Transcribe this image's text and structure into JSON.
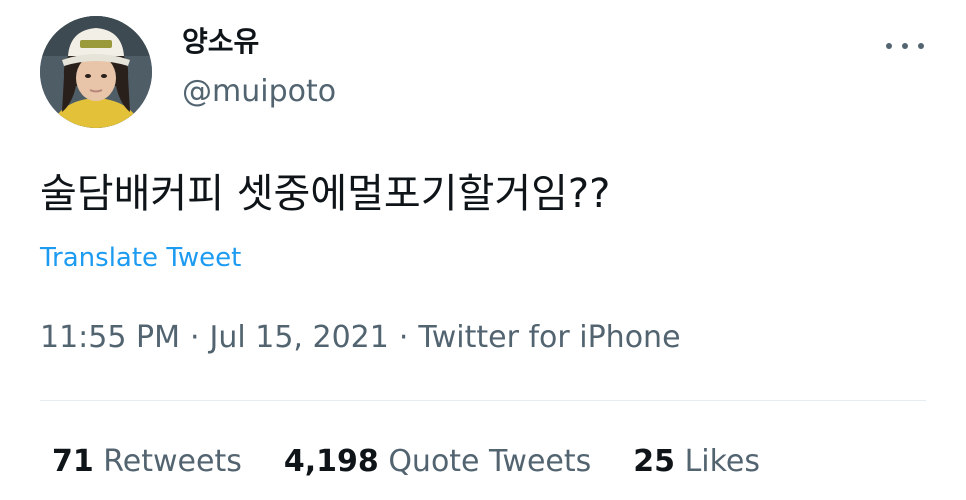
{
  "user": {
    "display_name": "양소유",
    "handle": "@muipoto",
    "avatar_icon": "profile-photo"
  },
  "more_icon": "more-horizontal-icon",
  "tweet": {
    "text": "술담배커피 셋중에멀포기할거임??",
    "translate_label": "Translate Tweet",
    "time": "11:55 PM",
    "separator": "·",
    "date": "Jul 15, 2021",
    "source": "Twitter for iPhone"
  },
  "stats": {
    "retweets": {
      "count": "71",
      "label": "Retweets"
    },
    "quote_tweets": {
      "count": "4,198",
      "label": "Quote Tweets"
    },
    "likes": {
      "count": "25",
      "label": "Likes"
    }
  },
  "colors": {
    "link": "#1d9bf0",
    "secondary_text": "#536471",
    "primary_text": "#0f1419",
    "divider": "#e6ecf0"
  }
}
